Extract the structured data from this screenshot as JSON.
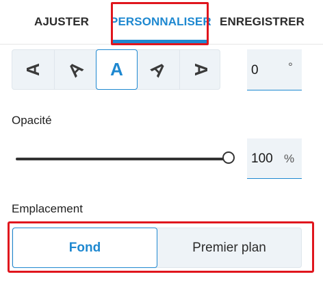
{
  "tabs": {
    "ajuster": "AJUSTER",
    "personnaliser": "PERSONNALISER",
    "enregistrer": "ENREGISTRER",
    "active": "PERSONNALISER"
  },
  "orientation": {
    "glyph": "A",
    "options": [
      "rotate-left-90",
      "rotate-left-45",
      "upright",
      "rotate-right-45",
      "rotate-right-90"
    ],
    "selected": "upright",
    "angle_value": "0",
    "angle_unit": "°"
  },
  "opacity": {
    "label": "Opacité",
    "value": "100",
    "unit": "%",
    "slider_level_percent": 100
  },
  "placement": {
    "label": "Emplacement",
    "options": [
      "Fond",
      "Premier plan"
    ],
    "selected": "Fond"
  },
  "colors": {
    "accent": "#1e88d0",
    "highlight": "#e0151d",
    "field_bg": "#eef3f7"
  }
}
